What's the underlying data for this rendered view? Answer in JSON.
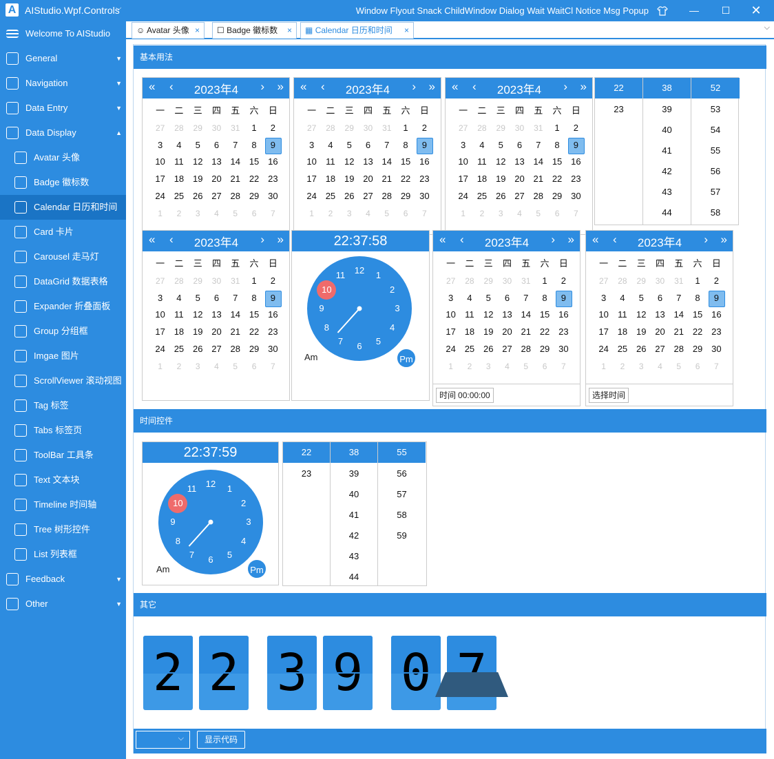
{
  "window": {
    "title": "AIStudio.Wpf.Controls",
    "title_chevron": "⌵",
    "links": "Window Flyout Snack ChildWindow Dialog Wait WaitCl Notice Msg Popup",
    "icons": [
      "skin-icon",
      "minimize-icon",
      "maximize-icon",
      "close-icon"
    ]
  },
  "sidebar": {
    "welcome": "Welcome To AIStudio",
    "items": [
      {
        "label": "General",
        "icon": "home-icon",
        "arrow": "▼"
      },
      {
        "label": "Navigation",
        "icon": "compass-icon",
        "arrow": "▼"
      },
      {
        "label": "Data Entry",
        "icon": "edit-icon",
        "arrow": "▼"
      },
      {
        "label": "Data Display",
        "icon": "document-icon",
        "arrow": "▲"
      },
      {
        "label": "Avatar 头像",
        "icon": "avatar-icon"
      },
      {
        "label": "Badge 徽标数",
        "icon": "badge-icon"
      },
      {
        "label": "Calendar 日历和时间",
        "icon": "calendar-icon"
      },
      {
        "label": "Card 卡片",
        "icon": "card-icon"
      },
      {
        "label": "Carousel 走马灯",
        "icon": "carousel-icon"
      },
      {
        "label": "DataGrid 数据表格",
        "icon": "grid-icon"
      },
      {
        "label": "Expander 折叠面板",
        "icon": "expander-icon"
      },
      {
        "label": "Group 分组框",
        "icon": "group-icon"
      },
      {
        "label": "Imgae 图片",
        "icon": "image-icon"
      },
      {
        "label": "ScrollViewer 滚动视图",
        "icon": "scroll-icon"
      },
      {
        "label": "Tag 标签",
        "icon": "tag-icon"
      },
      {
        "label": "Tabs 标签页",
        "icon": "tabs-icon"
      },
      {
        "label": "ToolBar 工具条",
        "icon": "toolbar-icon"
      },
      {
        "label": "Text 文本块",
        "icon": "text-icon"
      },
      {
        "label": "Timeline 时间轴",
        "icon": "timeline-icon"
      },
      {
        "label": "Tree 树形控件",
        "icon": "tree-icon"
      },
      {
        "label": "List 列表框",
        "icon": "list-icon"
      },
      {
        "label": "Feedback",
        "icon": "feedback-icon",
        "arrow": "▼"
      },
      {
        "label": "Other",
        "icon": "other-icon",
        "arrow": "▼"
      }
    ]
  },
  "tabs": [
    {
      "label": "Avatar 头像",
      "close": "×"
    },
    {
      "label": "Badge 徽标数",
      "close": "×"
    },
    {
      "label": "Calendar 日历和时间",
      "close": "×"
    }
  ],
  "tab_more": "⌵",
  "sections": {
    "basic": "基本用法",
    "time": "时间控件",
    "other": "其它"
  },
  "calendar": {
    "title": "2023年4月",
    "nav": {
      "prev2": "«",
      "prev": "‹",
      "next": "›",
      "next2": "»"
    },
    "weekdays": [
      "一",
      "二",
      "三",
      "四",
      "五",
      "六",
      "日"
    ],
    "weeks": [
      [
        {
          "d": "27",
          "dim": true
        },
        {
          "d": "28",
          "dim": true
        },
        {
          "d": "29",
          "dim": true
        },
        {
          "d": "30",
          "dim": true
        },
        {
          "d": "31",
          "dim": true
        },
        {
          "d": "1"
        },
        {
          "d": "2"
        }
      ],
      [
        {
          "d": "3"
        },
        {
          "d": "4"
        },
        {
          "d": "5"
        },
        {
          "d": "6"
        },
        {
          "d": "7"
        },
        {
          "d": "8"
        },
        {
          "d": "9",
          "sel": true
        }
      ],
      [
        {
          "d": "10"
        },
        {
          "d": "11"
        },
        {
          "d": "12"
        },
        {
          "d": "13"
        },
        {
          "d": "14"
        },
        {
          "d": "15"
        },
        {
          "d": "16"
        }
      ],
      [
        {
          "d": "17"
        },
        {
          "d": "18"
        },
        {
          "d": "19"
        },
        {
          "d": "20"
        },
        {
          "d": "21"
        },
        {
          "d": "22"
        },
        {
          "d": "23"
        }
      ],
      [
        {
          "d": "24"
        },
        {
          "d": "25"
        },
        {
          "d": "26"
        },
        {
          "d": "27"
        },
        {
          "d": "28"
        },
        {
          "d": "29"
        },
        {
          "d": "30"
        }
      ],
      [
        {
          "d": "1",
          "dim": true
        },
        {
          "d": "2",
          "dim": true
        },
        {
          "d": "3",
          "dim": true
        },
        {
          "d": "4",
          "dim": true
        },
        {
          "d": "5",
          "dim": true
        },
        {
          "d": "6",
          "dim": true
        },
        {
          "d": "7",
          "dim": true
        }
      ]
    ],
    "time_label": "时间",
    "time_value": "00:00:00",
    "select_time": "选择时间"
  },
  "time_columns_1": {
    "headers": [
      "22",
      "38",
      "52"
    ],
    "values": [
      [
        "23"
      ],
      [
        "39",
        "40",
        "41",
        "42",
        "43",
        "44"
      ],
      [
        "53",
        "54",
        "55",
        "56",
        "57",
        "58"
      ]
    ]
  },
  "time_columns_2": {
    "headers": [
      "22",
      "38",
      "55"
    ],
    "values": [
      [
        "23"
      ],
      [
        "39",
        "40",
        "41",
        "42",
        "43",
        "44"
      ],
      [
        "56",
        "57",
        "58",
        "59"
      ]
    ]
  },
  "clock1": {
    "time": "22:37:58",
    "selected": "10",
    "am": "Am",
    "pm": "Pm",
    "minute": 37
  },
  "clock2": {
    "time": "22:37:59",
    "selected": "10",
    "am": "Am",
    "pm": "Pm",
    "minute": 37
  },
  "clock_numbers": [
    "12",
    "1",
    "2",
    "3",
    "4",
    "5",
    "6",
    "7",
    "8",
    "9",
    "10",
    "11"
  ],
  "flip_digits": [
    "2",
    "2",
    "3",
    "9",
    "0",
    "7"
  ],
  "footer": {
    "select_chevron": "⌵",
    "show_code": "显示代码"
  },
  "colors": {
    "accent": "#2d8ce0",
    "selected_day": "#7fbcef",
    "hour_highlight": "#ef6b6b"
  }
}
